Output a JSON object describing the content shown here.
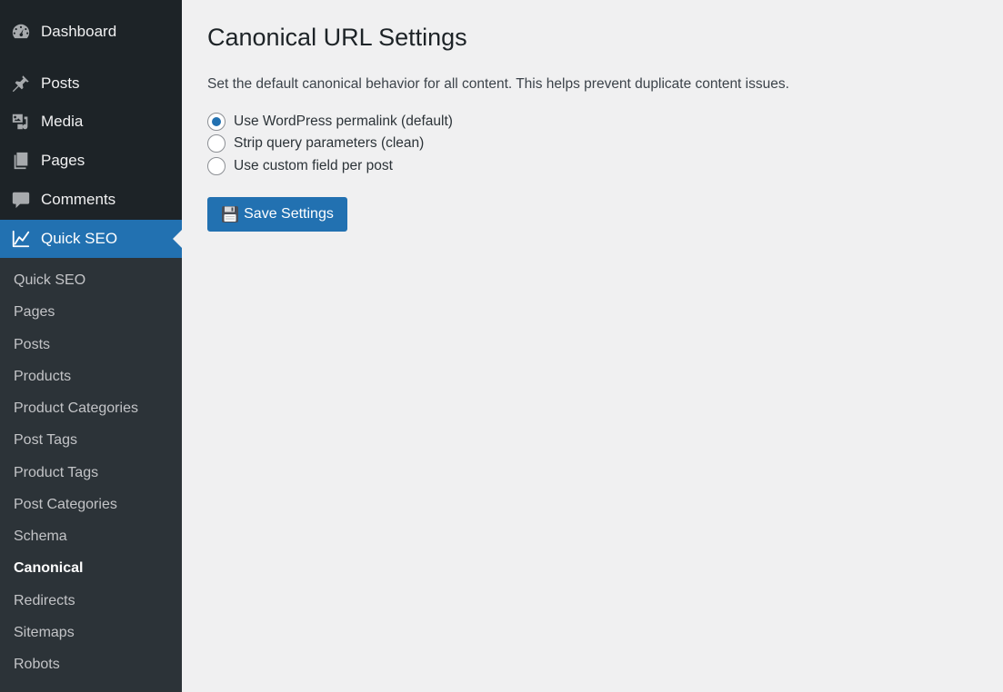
{
  "sidebar": {
    "menu": [
      {
        "label": "Dashboard",
        "icon": "dashboard-icon"
      },
      {
        "label": "Posts",
        "icon": "pin-icon"
      },
      {
        "label": "Media",
        "icon": "media-icon"
      },
      {
        "label": "Pages",
        "icon": "pages-icon"
      },
      {
        "label": "Comments",
        "icon": "comment-icon"
      },
      {
        "label": "Quick SEO",
        "icon": "chart-line-icon",
        "active": true
      }
    ],
    "submenu": [
      {
        "label": "Quick SEO"
      },
      {
        "label": "Pages"
      },
      {
        "label": "Posts"
      },
      {
        "label": "Products"
      },
      {
        "label": "Product Categories"
      },
      {
        "label": "Post Tags"
      },
      {
        "label": "Product Tags"
      },
      {
        "label": "Post Categories"
      },
      {
        "label": "Schema"
      },
      {
        "label": "Canonical",
        "current": true
      },
      {
        "label": "Redirects"
      },
      {
        "label": "Sitemaps"
      },
      {
        "label": "Robots"
      }
    ],
    "accent_color": "#2271b1",
    "background_color": "#1d2327"
  },
  "main": {
    "title": "Canonical URL Settings",
    "description": "Set the default canonical behavior for all content. This helps prevent duplicate content issues.",
    "options": [
      {
        "label": "Use WordPress permalink (default)",
        "checked": true
      },
      {
        "label": "Strip query parameters (clean)",
        "checked": false
      },
      {
        "label": "Use custom field per post",
        "checked": false
      }
    ],
    "save_label": "Save Settings",
    "save_icon": "floppy-disk-icon"
  }
}
